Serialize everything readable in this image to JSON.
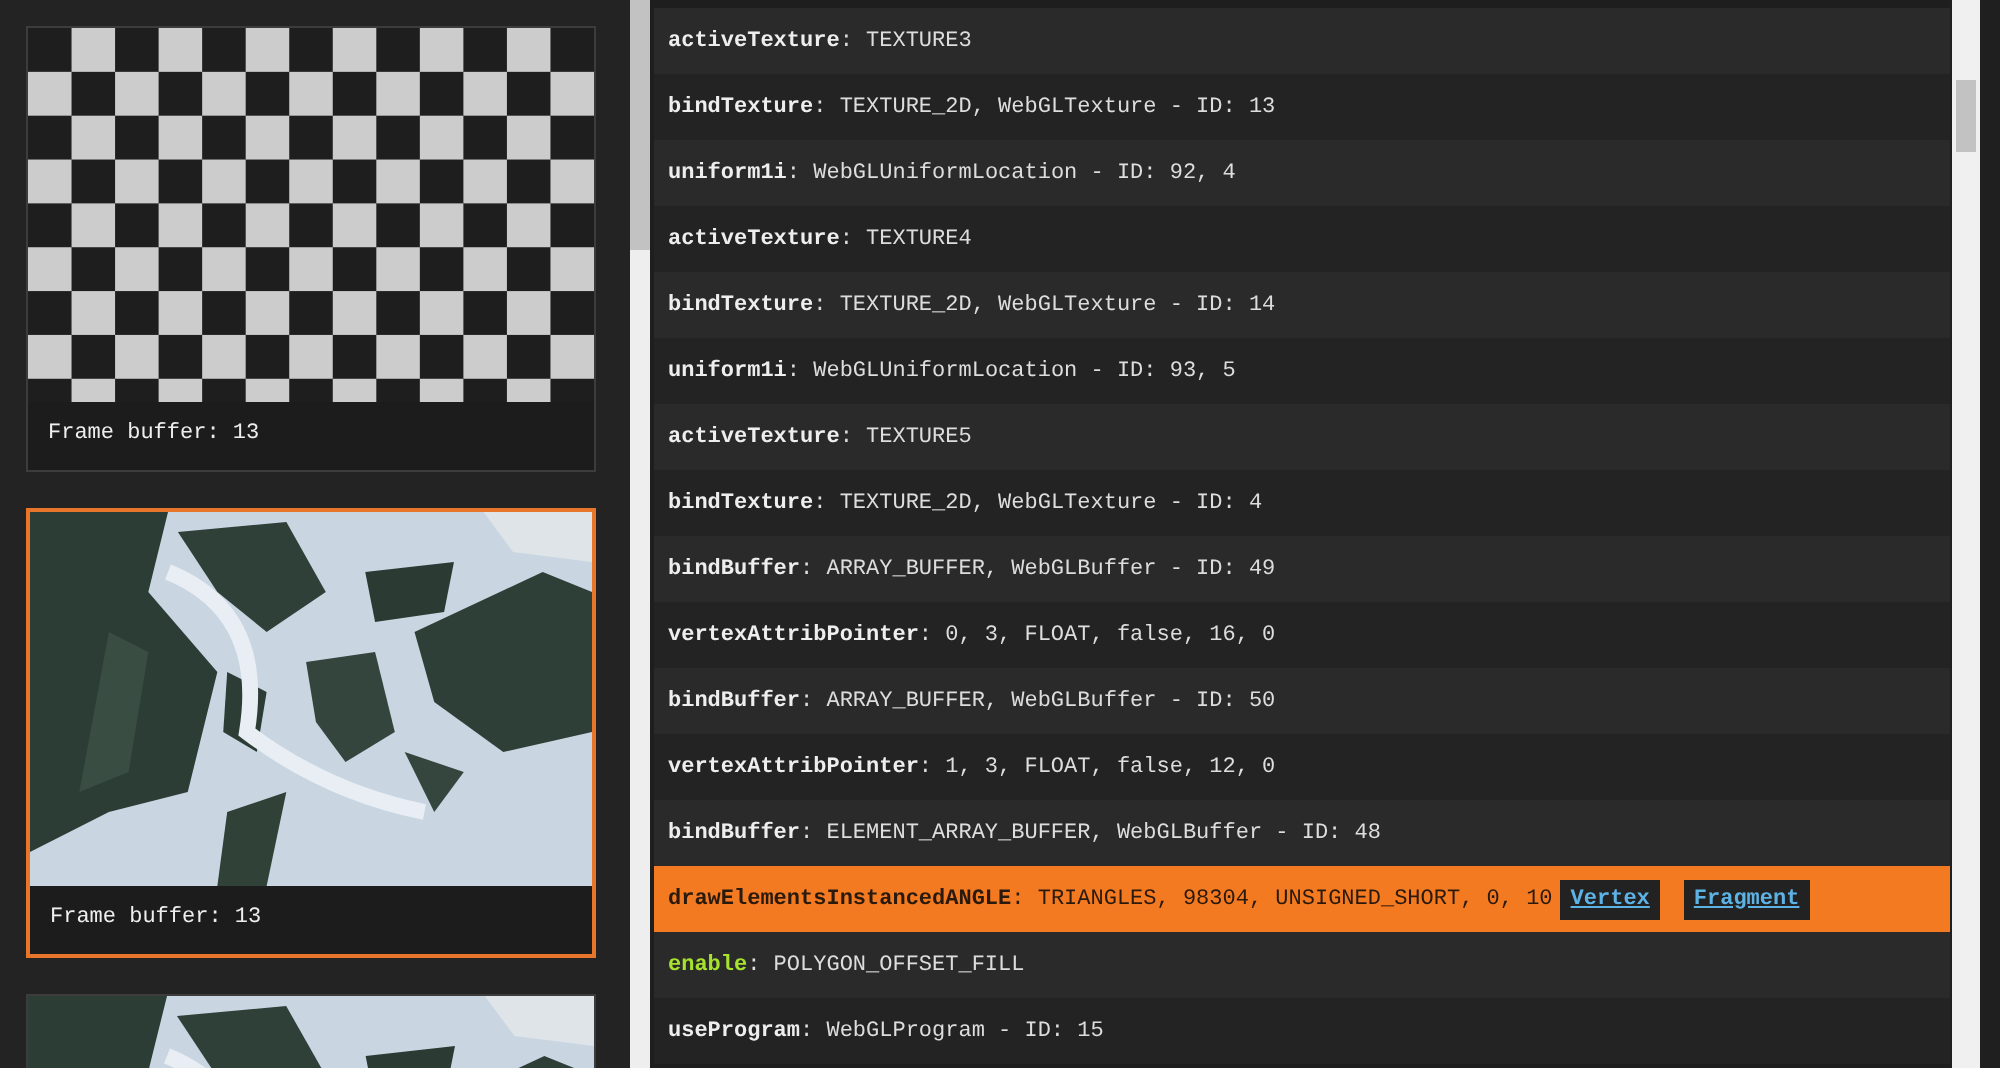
{
  "frames": [
    {
      "kind": "checker",
      "label": "Frame buffer: 13",
      "selected": false
    },
    {
      "kind": "picture",
      "label": "Frame buffer: 13",
      "selected": true
    },
    {
      "kind": "picture",
      "selected": false
    }
  ],
  "commands": [
    {
      "name": "activeTexture",
      "args": ": TEXTURE3",
      "color": "#eeeeee",
      "selected": false
    },
    {
      "name": "bindTexture",
      "args": ": TEXTURE_2D, WebGLTexture - ID: 13",
      "color": "#eeeeee",
      "selected": false
    },
    {
      "name": "uniform1i",
      "args": ": WebGLUniformLocation - ID: 92, 4",
      "color": "#eeeeee",
      "selected": false
    },
    {
      "name": "activeTexture",
      "args": ": TEXTURE4",
      "color": "#eeeeee",
      "selected": false
    },
    {
      "name": "bindTexture",
      "args": ": TEXTURE_2D, WebGLTexture - ID: 14",
      "color": "#eeeeee",
      "selected": false
    },
    {
      "name": "uniform1i",
      "args": ": WebGLUniformLocation - ID: 93, 5",
      "color": "#eeeeee",
      "selected": false
    },
    {
      "name": "activeTexture",
      "args": ": TEXTURE5",
      "color": "#eeeeee",
      "selected": false
    },
    {
      "name": "bindTexture",
      "args": ": TEXTURE_2D, WebGLTexture - ID: 4",
      "color": "#eeeeee",
      "selected": false
    },
    {
      "name": "bindBuffer",
      "args": ": ARRAY_BUFFER, WebGLBuffer - ID: 49",
      "color": "#eeeeee",
      "selected": false
    },
    {
      "name": "vertexAttribPointer",
      "args": ": 0, 3, FLOAT, false, 16, 0",
      "color": "#eeeeee",
      "selected": false
    },
    {
      "name": "bindBuffer",
      "args": ": ARRAY_BUFFER, WebGLBuffer - ID: 50",
      "color": "#eeeeee",
      "selected": false
    },
    {
      "name": "vertexAttribPointer",
      "args": ": 1, 3, FLOAT, false, 12, 0",
      "color": "#eeeeee",
      "selected": false
    },
    {
      "name": "bindBuffer",
      "args": ": ELEMENT_ARRAY_BUFFER, WebGLBuffer - ID: 48",
      "color": "#eeeeee",
      "selected": false
    },
    {
      "name": "drawElementsInstancedANGLE",
      "args": ": TRIANGLES, 98304, UNSIGNED_SHORT, 0, 10",
      "color": "#2a1a0e",
      "selected": true,
      "links": [
        "Vertex",
        "Fragment"
      ]
    },
    {
      "name": "enable",
      "args": ": POLYGON_OFFSET_FILL",
      "color": "#a6e22e",
      "selected": false
    },
    {
      "name": "useProgram",
      "args": ": WebGLProgram - ID: 15",
      "color": "#eeeeee",
      "selected": false
    }
  ]
}
